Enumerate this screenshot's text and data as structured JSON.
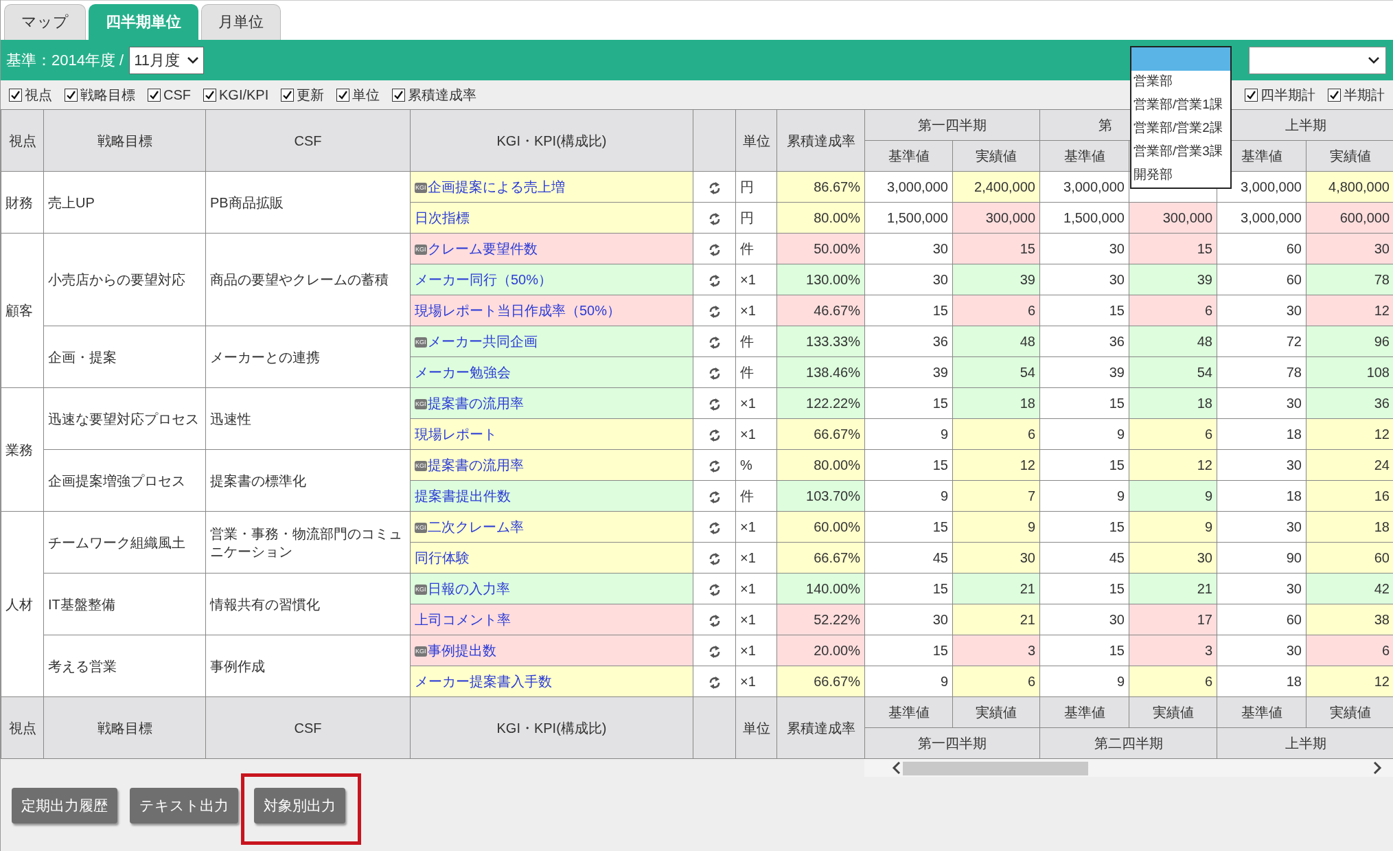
{
  "tabs": [
    {
      "label": "マップ",
      "selected": false
    },
    {
      "label": "四半期単位",
      "selected": true
    },
    {
      "label": "月単位",
      "selected": false
    }
  ],
  "toolbar": {
    "base_label": "基準：2014年度 /",
    "month_select": {
      "value": "11月度"
    },
    "org_select": {
      "expanded": true,
      "blank_option_highlighted": true,
      "options": [
        {
          "label": "営業部"
        },
        {
          "label": "営業部/営業1課"
        },
        {
          "label": "営業部/営業2課"
        },
        {
          "label": "営業部/営業3課"
        },
        {
          "label": "開発部"
        }
      ]
    }
  },
  "column_toggles": [
    {
      "label": "視点",
      "checked": true
    },
    {
      "label": "戦略目標",
      "checked": true
    },
    {
      "label": "CSF",
      "checked": true
    },
    {
      "label": "KGI/KPI",
      "checked": true
    },
    {
      "label": "更新",
      "checked": true
    },
    {
      "label": "単位",
      "checked": true
    },
    {
      "label": "累積達成率",
      "checked": true
    }
  ],
  "total_toggles": [
    {
      "label": "四半期計",
      "checked": true
    },
    {
      "label": "半期計",
      "checked": true
    }
  ],
  "table": {
    "header": {
      "columns": [
        "視点",
        "戦略目標",
        "CSF",
        "KGI・KPI(構成比)",
        "",
        "単位",
        "累積達成率"
      ],
      "groups": [
        {
          "title": "第一四半期",
          "subcolumns": [
            "基準値",
            "実績値"
          ]
        },
        {
          "title": "第",
          "subcolumns": [
            "基準値",
            null
          ]
        },
        {
          "title": "上半期",
          "subcolumns": [
            "基準値",
            "実績値"
          ]
        }
      ]
    },
    "perspectives": [
      {
        "name": "財務",
        "goals": [
          {
            "goal": "売上UP",
            "csf": "PB商品拡販",
            "kpis": [
              {
                "kgi": true,
                "badge": "KGI",
                "name": "企画提案による売上増",
                "color": "#ffffcc",
                "unit": "円",
                "rate": "86.67%",
                "cells": [
                  {
                    "text": "3,000,000"
                  },
                  {
                    "text": "2,400,000",
                    "color": "#ffffcc"
                  },
                  {
                    "text": "3,000,000"
                  },
                  {},
                  {
                    "text": "3,000,000"
                  },
                  {
                    "text": "4,800,000",
                    "color": "#ffffcc"
                  }
                ]
              },
              {
                "kgi": false,
                "name": "日次指標",
                "color": "#ffffcc",
                "unit": "円",
                "rate": "80.00%",
                "cells": [
                  {
                    "text": "1,500,000"
                  },
                  {
                    "text": "300,000",
                    "color": "#ffdddd"
                  },
                  {
                    "text": "1,500,000"
                  },
                  {
                    "text": "300,000",
                    "color": "#ffdddd"
                  },
                  {
                    "text": "3,000,000"
                  },
                  {
                    "text": "600,000",
                    "color": "#ffdddd"
                  }
                ]
              }
            ]
          }
        ]
      },
      {
        "name": "顧客",
        "goals": [
          {
            "goal": "小売店からの要望対応",
            "csf": "商品の要望やクレームの蓄積",
            "kpis": [
              {
                "kgi": true,
                "badge": "KGI",
                "name": "クレーム要望件数",
                "color": "#ffdddd",
                "unit": "件",
                "rate": "50.00%",
                "cells": [
                  {
                    "text": "30"
                  },
                  {
                    "text": "15",
                    "color": "#ffdddd"
                  },
                  {
                    "text": "30"
                  },
                  {
                    "text": "15",
                    "color": "#ffdddd"
                  },
                  {
                    "text": "60"
                  },
                  {
                    "text": "30",
                    "color": "#ffdddd"
                  }
                ]
              },
              {
                "kgi": false,
                "name": "メーカー同行（50%）",
                "color": "#ddfddd",
                "unit": "×1",
                "rate": "130.00%",
                "cells": [
                  {
                    "text": "30"
                  },
                  {
                    "text": "39",
                    "color": "#ddfddd"
                  },
                  {
                    "text": "30"
                  },
                  {
                    "text": "39",
                    "color": "#ddfddd"
                  },
                  {
                    "text": "60"
                  },
                  {
                    "text": "78",
                    "color": "#ddfddd"
                  }
                ]
              },
              {
                "kgi": false,
                "name": "現場レポート当日作成率（50%）",
                "color": "#ffdddd",
                "unit": "×1",
                "rate": "46.67%",
                "cells": [
                  {
                    "text": "15"
                  },
                  {
                    "text": "6",
                    "color": "#ffdddd"
                  },
                  {
                    "text": "15"
                  },
                  {
                    "text": "6",
                    "color": "#ffdddd"
                  },
                  {
                    "text": "30"
                  },
                  {
                    "text": "12",
                    "color": "#ffdddd"
                  }
                ]
              }
            ]
          },
          {
            "goal": "企画・提案",
            "csf": "メーカーとの連携",
            "kpis": [
              {
                "kgi": true,
                "badge": "KGI",
                "name": "メーカー共同企画",
                "color": "#ddfddd",
                "unit": "件",
                "rate": "133.33%",
                "cells": [
                  {
                    "text": "36"
                  },
                  {
                    "text": "48",
                    "color": "#ddfddd"
                  },
                  {
                    "text": "36"
                  },
                  {
                    "text": "48",
                    "color": "#ddfddd"
                  },
                  {
                    "text": "72"
                  },
                  {
                    "text": "96",
                    "color": "#ddfddd"
                  }
                ]
              },
              {
                "kgi": false,
                "name": "メーカー勉強会",
                "color": "#ddfddd",
                "unit": "件",
                "rate": "138.46%",
                "cells": [
                  {
                    "text": "39"
                  },
                  {
                    "text": "54",
                    "color": "#ddfddd"
                  },
                  {
                    "text": "39"
                  },
                  {
                    "text": "54",
                    "color": "#ddfddd"
                  },
                  {
                    "text": "78"
                  },
                  {
                    "text": "108",
                    "color": "#ddfddd"
                  }
                ]
              }
            ]
          }
        ]
      },
      {
        "name": "業務",
        "goals": [
          {
            "goal": "迅速な要望対応プロセス",
            "csf": "迅速性",
            "kpis": [
              {
                "kgi": true,
                "badge": "KGI",
                "name": "提案書の流用率",
                "color": "#ddfddd",
                "unit": "×1",
                "rate": "122.22%",
                "cells": [
                  {
                    "text": "15"
                  },
                  {
                    "text": "18",
                    "color": "#ddfddd"
                  },
                  {
                    "text": "15"
                  },
                  {
                    "text": "18",
                    "color": "#ddfddd"
                  },
                  {
                    "text": "30"
                  },
                  {
                    "text": "36",
                    "color": "#ddfddd"
                  }
                ]
              },
              {
                "kgi": false,
                "name": "現場レポート",
                "color": "#ffffcc",
                "unit": "×1",
                "rate": "66.67%",
                "cells": [
                  {
                    "text": "9"
                  },
                  {
                    "text": "6",
                    "color": "#ffffcc"
                  },
                  {
                    "text": "9"
                  },
                  {
                    "text": "6",
                    "color": "#ffffcc"
                  },
                  {
                    "text": "18"
                  },
                  {
                    "text": "12",
                    "color": "#ffffcc"
                  }
                ]
              }
            ]
          },
          {
            "goal": "企画提案増強プロセス",
            "csf": "提案書の標準化",
            "kpis": [
              {
                "kgi": true,
                "badge": "KGI",
                "name": "提案書の流用率",
                "color": "#ffffcc",
                "unit": "%",
                "rate": "80.00%",
                "cells": [
                  {
                    "text": "15"
                  },
                  {
                    "text": "12",
                    "color": "#ffffcc"
                  },
                  {
                    "text": "15"
                  },
                  {
                    "text": "12",
                    "color": "#ffffcc"
                  },
                  {
                    "text": "30"
                  },
                  {
                    "text": "24",
                    "color": "#ffffcc"
                  }
                ]
              },
              {
                "kgi": false,
                "name": "提案書提出件数",
                "color": "#ddfddd",
                "unit": "件",
                "rate": "103.70%",
                "cells": [
                  {
                    "text": "9"
                  },
                  {
                    "text": "7",
                    "color": "#ffffcc"
                  },
                  {
                    "text": "9"
                  },
                  {
                    "text": "9",
                    "color": "#ddfddd"
                  },
                  {
                    "text": "18"
                  },
                  {
                    "text": "16",
                    "color": "#ffffcc"
                  }
                ]
              }
            ]
          }
        ]
      },
      {
        "name": "人材",
        "goals": [
          {
            "goal": "チームワーク組織風土",
            "csf": "営業・事務・物流部門のコミュニケーション",
            "kpis": [
              {
                "kgi": true,
                "badge": "KGI",
                "name": "二次クレーム率",
                "color": "#ffffcc",
                "unit": "×1",
                "rate": "60.00%",
                "cells": [
                  {
                    "text": "15"
                  },
                  {
                    "text": "9",
                    "color": "#ffffcc"
                  },
                  {
                    "text": "15"
                  },
                  {
                    "text": "9",
                    "color": "#ffffcc"
                  },
                  {
                    "text": "30"
                  },
                  {
                    "text": "18",
                    "color": "#ffffcc"
                  }
                ]
              },
              {
                "kgi": false,
                "name": "同行体験",
                "color": "#ffffcc",
                "unit": "×1",
                "rate": "66.67%",
                "cells": [
                  {
                    "text": "45"
                  },
                  {
                    "text": "30",
                    "color": "#ffffcc"
                  },
                  {
                    "text": "45"
                  },
                  {
                    "text": "30",
                    "color": "#ffffcc"
                  },
                  {
                    "text": "90"
                  },
                  {
                    "text": "60",
                    "color": "#ffffcc"
                  }
                ]
              }
            ]
          },
          {
            "goal": "IT基盤整備",
            "csf": "情報共有の習慣化",
            "kpis": [
              {
                "kgi": true,
                "badge": "KGI",
                "name": "日報の入力率",
                "color": "#ddfddd",
                "unit": "×1",
                "rate": "140.00%",
                "cells": [
                  {
                    "text": "15"
                  },
                  {
                    "text": "21",
                    "color": "#ddfddd"
                  },
                  {
                    "text": "15"
                  },
                  {
                    "text": "21",
                    "color": "#ddfddd"
                  },
                  {
                    "text": "30"
                  },
                  {
                    "text": "42",
                    "color": "#ddfddd"
                  }
                ]
              },
              {
                "kgi": false,
                "name": "上司コメント率",
                "color": "#ffdddd",
                "unit": "×1",
                "rate": "52.22%",
                "cells": [
                  {
                    "text": "30"
                  },
                  {
                    "text": "21",
                    "color": "#ffffcc"
                  },
                  {
                    "text": "30"
                  },
                  {
                    "text": "17",
                    "color": "#ffdddd"
                  },
                  {
                    "text": "60"
                  },
                  {
                    "text": "38",
                    "color": "#ffffcc"
                  }
                ]
              }
            ]
          },
          {
            "goal": "考える営業",
            "csf": "事例作成",
            "kpis": [
              {
                "kgi": true,
                "badge": "KGI",
                "name": "事例提出数",
                "color": "#ffdddd",
                "unit": "×1",
                "rate": "20.00%",
                "cells": [
                  {
                    "text": "15"
                  },
                  {
                    "text": "3",
                    "color": "#ffdddd"
                  },
                  {
                    "text": "15"
                  },
                  {
                    "text": "3",
                    "color": "#ffdddd"
                  },
                  {
                    "text": "30"
                  },
                  {
                    "text": "6",
                    "color": "#ffdddd"
                  }
                ]
              },
              {
                "kgi": false,
                "name": "メーカー提案書入手数",
                "color": "#ffffcc",
                "unit": "×1",
                "rate": "66.67%",
                "cells": [
                  {
                    "text": "9"
                  },
                  {
                    "text": "6",
                    "color": "#ffffcc"
                  },
                  {
                    "text": "9"
                  },
                  {
                    "text": "6",
                    "color": "#ffffcc"
                  },
                  {
                    "text": "18"
                  },
                  {
                    "text": "12",
                    "color": "#ffffcc"
                  }
                ]
              }
            ]
          }
        ]
      }
    ],
    "footer": {
      "columns": [
        "視点",
        "戦略目標",
        "CSF",
        "KGI・KPI(構成比)",
        "",
        "単位",
        "累積達成率"
      ],
      "groups": [
        {
          "title": "第一四半期",
          "subcolumns": [
            "基準値",
            "実績値"
          ]
        },
        {
          "title": "第二四半期",
          "subcolumns": [
            "基準値",
            "実績値"
          ]
        },
        {
          "title": "上半期",
          "subcolumns": [
            "基準値",
            "実績値"
          ]
        }
      ]
    }
  },
  "buttons": [
    {
      "label": "定期出力履歴",
      "highlighted": false
    },
    {
      "label": "テキスト出力",
      "highlighted": false
    },
    {
      "label": "対象別出力",
      "highlighted": true
    }
  ]
}
